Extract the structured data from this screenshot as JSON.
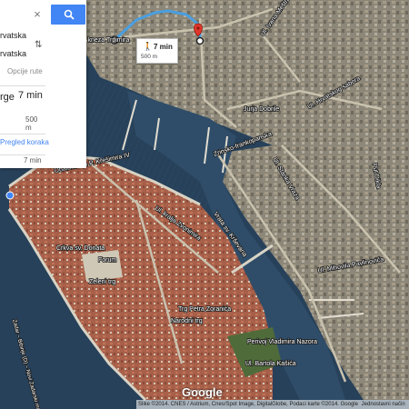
{
  "directions_panel": {
    "search_query": "",
    "clear_label": "×",
    "origin_value": "rvatska",
    "destination_value": "rvatska",
    "swap_label": "⇅",
    "options_label": "Opcije rute",
    "route_name": "rge",
    "route_time": "7 min",
    "route_distance": "500 m",
    "steps_link": "Pregled koraka",
    "mode_time": "7 min"
  },
  "route_popup": {
    "time": "7 min",
    "distance": "500 m"
  },
  "map_labels": {
    "street_main": "Ul. kneza Trpimira",
    "obala": "Obala kralja P. Krešimira IV",
    "crkva": "Crkva sv. Donata",
    "forum": "Forum",
    "zeleni_trg": "Zeleni trg",
    "petra_zoranica": "Trg Petra Zoranića",
    "narodni": "Narodni trg",
    "zadar_bridge": "Zadar – Bibinje (D) – Novi Zadarski most",
    "kralja": "Ul. kralja Zvonimira",
    "jurja": "Jurja Dobrile",
    "bartola": "Ul. Bartola Kašića",
    "varos": "Vrata sv. Krševana",
    "park": "Perivoj Vladimira Nazora",
    "stanka": "Ul. Stanka Vraza",
    "put_dikla": "Put Dikla",
    "ivana_mestrovica": "Ul. Ivana Meštrovića",
    "kozjacka": "Ul. Hrvatskog sabora",
    "hrvatska_obala": "Zrinsko-frankopanska",
    "mihovila": "Ul. Mihovila Pavlinovića"
  },
  "map": {
    "logo": "Google",
    "attribution": "Slike ©2014. CNES / Astrium, Cnes/Spot Image, DigitalGlobe, Podaci karte ©2014. Google",
    "terms": "Jednostavni način"
  },
  "colors": {
    "sea": "#27415a",
    "land": "#8a8672",
    "roof": "#b0624a",
    "route": "#4a9fe0",
    "accent": "#4285f4",
    "marker": "#e0362b"
  }
}
